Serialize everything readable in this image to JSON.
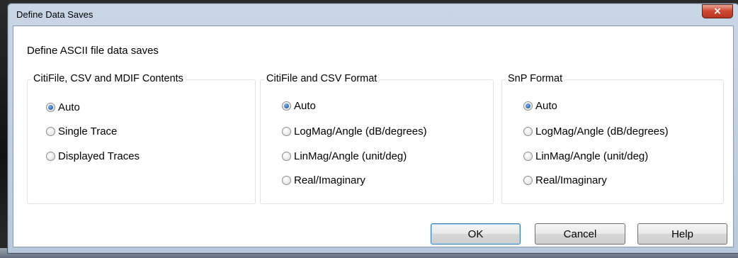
{
  "dialog": {
    "title": "Define Data Saves",
    "close_glyph": "×",
    "header": "Define ASCII file data saves"
  },
  "groups": [
    {
      "label": "CitiFile, CSV and MDIF Contents",
      "options": [
        {
          "label": "Auto",
          "checked": true
        },
        {
          "label": "Single Trace",
          "checked": false
        },
        {
          "label": "Displayed Traces",
          "checked": false
        }
      ]
    },
    {
      "label": "CitiFile and CSV Format",
      "options": [
        {
          "label": "Auto",
          "checked": true
        },
        {
          "label": "LogMag/Angle (dB/degrees)",
          "checked": false
        },
        {
          "label": "LinMag/Angle (unit/deg)",
          "checked": false
        },
        {
          "label": "Real/Imaginary",
          "checked": false
        }
      ]
    },
    {
      "label": "SnP Format",
      "options": [
        {
          "label": "Auto",
          "checked": true
        },
        {
          "label": "LogMag/Angle (dB/degrees)",
          "checked": false
        },
        {
          "label": "LinMag/Angle (unit/deg)",
          "checked": false
        },
        {
          "label": "Real/Imaginary",
          "checked": false
        }
      ]
    }
  ],
  "buttons": {
    "ok": "OK",
    "cancel": "Cancel",
    "help": "Help"
  }
}
